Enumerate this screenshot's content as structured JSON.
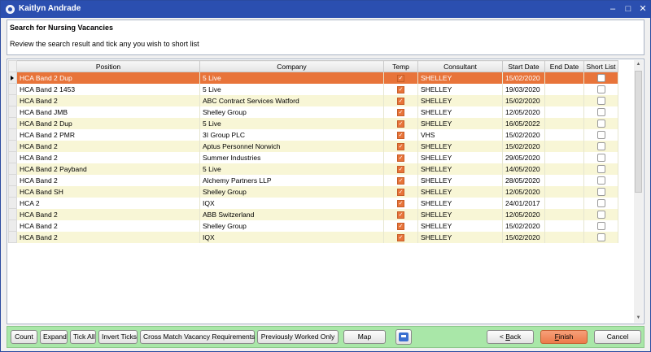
{
  "window": {
    "title": "Kaitlyn Andrade",
    "minimize": "–",
    "maximize": "□",
    "close": "✕"
  },
  "header": {
    "title": "Search for Nursing Vacancies",
    "subtitle": "Review the search result and tick any you wish to short list"
  },
  "grid": {
    "columns": {
      "position": "Position",
      "company": "Company",
      "temp": "Temp",
      "consultant": "Consultant",
      "start_date": "Start Date",
      "end_date": "End Date",
      "short_list": "Short List"
    },
    "rows": [
      {
        "position": "HCA Band 2 Dup",
        "company": "5 Live",
        "temp": true,
        "consultant": "SHELLEY",
        "start_date": "15/02/2020",
        "end_date": "",
        "short_list": false,
        "selected": true
      },
      {
        "position": "HCA Band 2 1453",
        "company": "5 Live",
        "temp": true,
        "consultant": "SHELLEY",
        "start_date": "19/03/2020",
        "end_date": "",
        "short_list": false
      },
      {
        "position": "HCA Band 2",
        "company": "ABC Contract Services Watford",
        "temp": true,
        "consultant": "SHELLEY",
        "start_date": "15/02/2020",
        "end_date": "",
        "short_list": false
      },
      {
        "position": "HCA Band JMB",
        "company": "Shelley Group",
        "temp": true,
        "consultant": "SHELLEY",
        "start_date": "12/05/2020",
        "end_date": "",
        "short_list": false
      },
      {
        "position": "HCA Band 2 Dup",
        "company": "5 Live",
        "temp": true,
        "consultant": "SHELLEY",
        "start_date": "16/05/2022",
        "end_date": "",
        "short_list": false
      },
      {
        "position": "HCA Band 2 PMR",
        "company": "3I Group PLC",
        "temp": true,
        "consultant": "VHS",
        "start_date": "15/02/2020",
        "end_date": "",
        "short_list": false
      },
      {
        "position": "HCA Band 2",
        "company": "Aptus Personnel Norwich",
        "temp": true,
        "consultant": "SHELLEY",
        "start_date": "15/02/2020",
        "end_date": "",
        "short_list": false
      },
      {
        "position": "HCA Band 2",
        "company": "Summer Industries",
        "temp": true,
        "consultant": "SHELLEY",
        "start_date": "29/05/2020",
        "end_date": "",
        "short_list": false
      },
      {
        "position": "HCA Band 2 Payband",
        "company": "5 Live",
        "temp": true,
        "consultant": "SHELLEY",
        "start_date": "14/05/2020",
        "end_date": "",
        "short_list": false
      },
      {
        "position": "HCA Band 2",
        "company": "Alchemy Partners LLP",
        "temp": true,
        "consultant": "SHELLEY",
        "start_date": "28/05/2020",
        "end_date": "",
        "short_list": false
      },
      {
        "position": "HCA Band SH",
        "company": "Shelley Group",
        "temp": true,
        "consultant": "SHELLEY",
        "start_date": "12/05/2020",
        "end_date": "",
        "short_list": false
      },
      {
        "position": "HCA 2",
        "company": "IQX",
        "temp": true,
        "consultant": "SHELLEY",
        "start_date": "24/01/2017",
        "end_date": "",
        "short_list": false
      },
      {
        "position": "HCA Band 2",
        "company": "ABB Switzerland",
        "temp": true,
        "consultant": "SHELLEY",
        "start_date": "12/05/2020",
        "end_date": "",
        "short_list": false
      },
      {
        "position": "HCA Band 2",
        "company": "Shelley Group",
        "temp": true,
        "consultant": "SHELLEY",
        "start_date": "15/02/2020",
        "end_date": "",
        "short_list": false
      },
      {
        "position": "HCA Band 2",
        "company": "IQX",
        "temp": true,
        "consultant": "SHELLEY",
        "start_date": "15/02/2020",
        "end_date": "",
        "short_list": false
      }
    ]
  },
  "footer": {
    "count": "Count",
    "expand": "Expand",
    "tick_all": "Tick All",
    "invert_ticks": "Invert Ticks",
    "cross_match": "Cross Match Vacancy Requirements",
    "previously_worked": "Previously Worked Only",
    "map": "Map",
    "back_key": "B",
    "back_rest": "ack",
    "back_prefix": "< ",
    "finish_key": "F",
    "finish_rest": "inish",
    "cancel": "Cancel"
  },
  "colors": {
    "titlebar": "#2b4fb0",
    "selected_row": "#e8743a",
    "alt_row": "#f8f6d6",
    "footer": "#a9e7a8",
    "finish_button": "#ed7a4a"
  }
}
